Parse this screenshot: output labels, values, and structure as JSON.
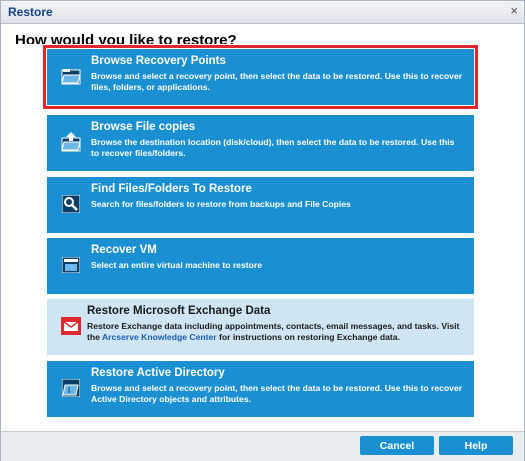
{
  "window": {
    "title": "Restore",
    "close_glyph": "×"
  },
  "question": "How would you like to restore?",
  "options": [
    {
      "heading": "Browse Recovery Points",
      "description": "Browse and select a recovery point, then select the data to be restored. Use this to recover files, folders, or applications.",
      "icon": "folder-open-icon",
      "selected": true
    },
    {
      "heading": "Browse File copies",
      "description": "Browse the destination location (disk/cloud), then select the data to be restored. Use this to recover files/folders.",
      "icon": "folder-upload-icon"
    },
    {
      "heading": "Find Files/Folders To Restore",
      "description": "Search for files/folders to restore from backups and File Copies",
      "icon": "search-icon"
    },
    {
      "heading": "Recover VM",
      "description": "Select an entire virtual machine to restore",
      "icon": "vm-icon"
    },
    {
      "heading": "Restore Microsoft Exchange Data",
      "description_before": "Restore Exchange data including appointments, contacts, email messages, and tasks. Visit the ",
      "link": "Arcserve Knowledge Center",
      "description_after": " for instructions on restoring Exchange data.",
      "icon": "exchange-mail-icon"
    },
    {
      "heading": "Restore Active Directory",
      "description": "Browse and select a recovery point, then select the data to be restored. Use this to recover Active Directory objects and attributes.",
      "icon": "active-directory-icon"
    }
  ],
  "buttons": {
    "cancel": "Cancel",
    "help": "Help"
  },
  "colors": {
    "accent": "#1a8fd1",
    "selected_border": "#e1262d",
    "exchange_bg": "#cfe5f3",
    "exchange_icon": "#e1262d"
  }
}
